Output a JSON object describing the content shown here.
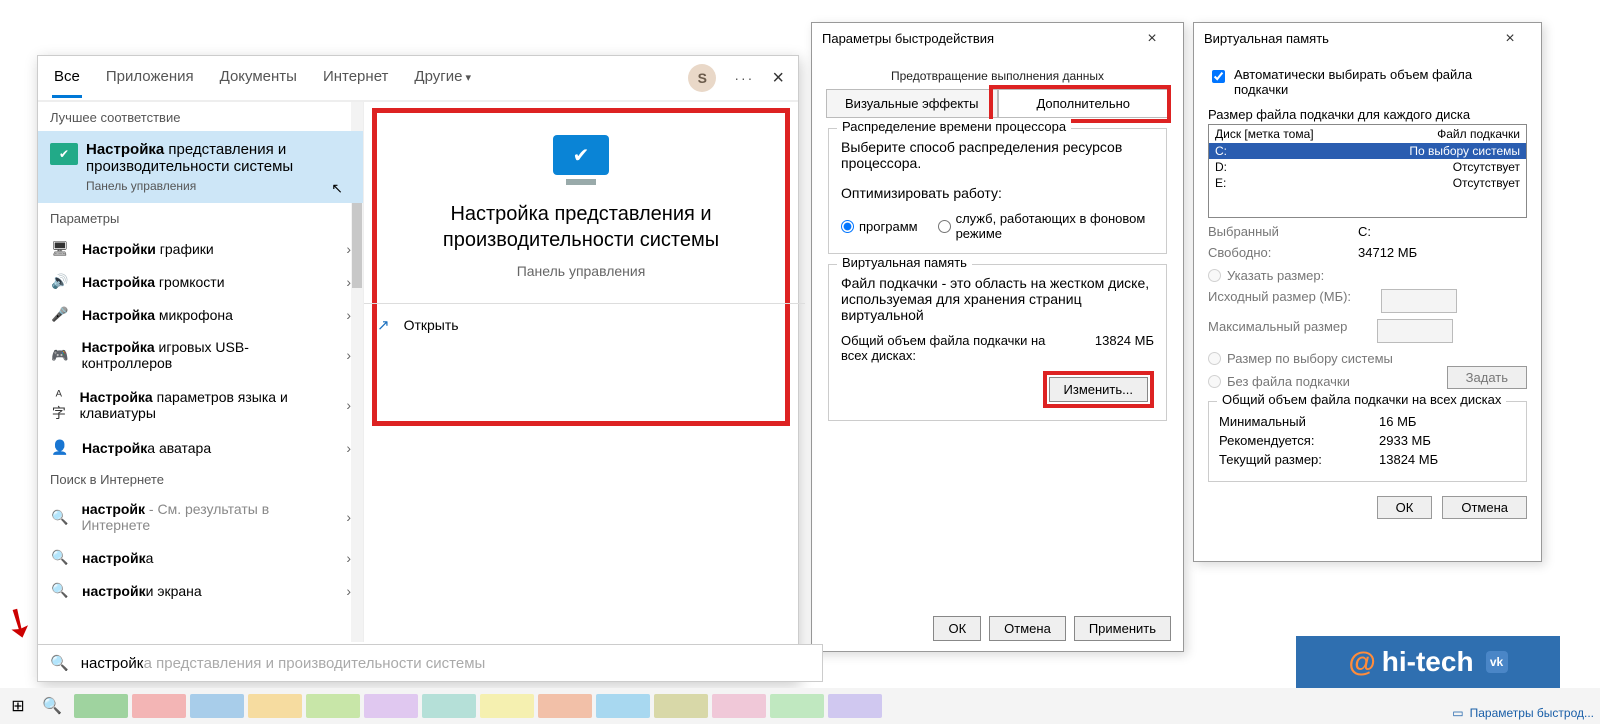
{
  "start": {
    "tabs": [
      "Все",
      "Приложения",
      "Документы",
      "Интернет",
      "Другие"
    ],
    "avatar_letter": "S",
    "cat_best": "Лучшее соответствие",
    "best_title_1": "Настройка",
    "best_title_2": " представления и производительности системы",
    "best_sub": "Панель управления",
    "cat_params": "Параметры",
    "items": [
      {
        "icon": "🖥",
        "bold": "Настройки",
        "rest": " графики"
      },
      {
        "icon": "🔊",
        "bold": "Настройка",
        "rest": " громкости"
      },
      {
        "icon": "🎤",
        "bold": "Настройка",
        "rest": " микрофона"
      },
      {
        "icon": "🎮",
        "bold": "Настройка",
        "rest": " игровых USB-контроллеров"
      },
      {
        "icon": "ᴬ字",
        "bold": "Настройка",
        "rest": " параметров языка и клавиатуры"
      },
      {
        "icon": "👤",
        "bold": "Настройк",
        "rest": "а аватара"
      }
    ],
    "cat_web": "Поиск в Интернете",
    "web": [
      {
        "bold": "настройк",
        "rest": " - См. результаты в Интернете"
      },
      {
        "bold": "настройк",
        "rest": "а"
      },
      {
        "bold": "настройк",
        "rest": "и экрана"
      }
    ],
    "right_title": "Настройка представления и производительности системы",
    "right_sub": "Панель управления",
    "open_label": "Открыть",
    "search_typed": "настройк",
    "search_ghost": "а представления и производительности системы"
  },
  "perf": {
    "title": "Параметры быстродействия",
    "dep": "Предотвращение выполнения данных",
    "tab1": "Визуальные эффекты",
    "tab2": "Дополнительно",
    "g1_legend": "Распределение времени процессора",
    "g1_text": "Выберите способ распределения ресурсов процессора.",
    "g1_opt_label": "Оптимизировать работу:",
    "g1_r1": "программ",
    "g1_r2": "служб, работающих в фоновом режиме",
    "g2_legend": "Виртуальная память",
    "g2_text": "Файл подкачки - это область на жестком диске, используемая для хранения страниц виртуальной",
    "g2_total_label": "Общий объем файла подкачки на всех дисках:",
    "g2_total_val": "13824 МБ",
    "change_btn": "Изменить...",
    "ok": "ОК",
    "cancel": "Отмена",
    "apply": "Применить"
  },
  "vm": {
    "title": "Виртуальная память",
    "auto": "Автоматически выбирать объем файла подкачки",
    "size_each": "Размер файла подкачки для каждого диска",
    "hdr_disk": "Диск [метка тома]",
    "hdr_file": "Файл подкачки",
    "rows": [
      {
        "d": "C:",
        "v": "По выбору системы",
        "sel": true
      },
      {
        "d": "D:",
        "v": "Отсутствует"
      },
      {
        "d": "E:",
        "v": "Отсутствует"
      }
    ],
    "sel_label": "Выбранный",
    "sel_val": "C:",
    "free_label": "Свободно:",
    "free_val": "34712 МБ",
    "opt_custom": "Указать размер:",
    "init_label": "Исходный размер (МБ):",
    "max_label": "Максимальный размер",
    "opt_sys": "Размер по выбору системы",
    "opt_none": "Без файла подкачки",
    "set_btn": "Задать",
    "tot_legend": "Общий объем файла подкачки на всех дисках",
    "min_l": "Минимальный",
    "min_v": "16 МБ",
    "rec_l": "Рекомендуется:",
    "rec_v": "2933 МБ",
    "cur_l": "Текущий размер:",
    "cur_v": "13824 МБ",
    "ok": "ОК",
    "cancel": "Отмена"
  },
  "taskbar": {
    "tray": "Параметры быстрод..."
  },
  "badge": {
    "text": "hi-tech"
  }
}
